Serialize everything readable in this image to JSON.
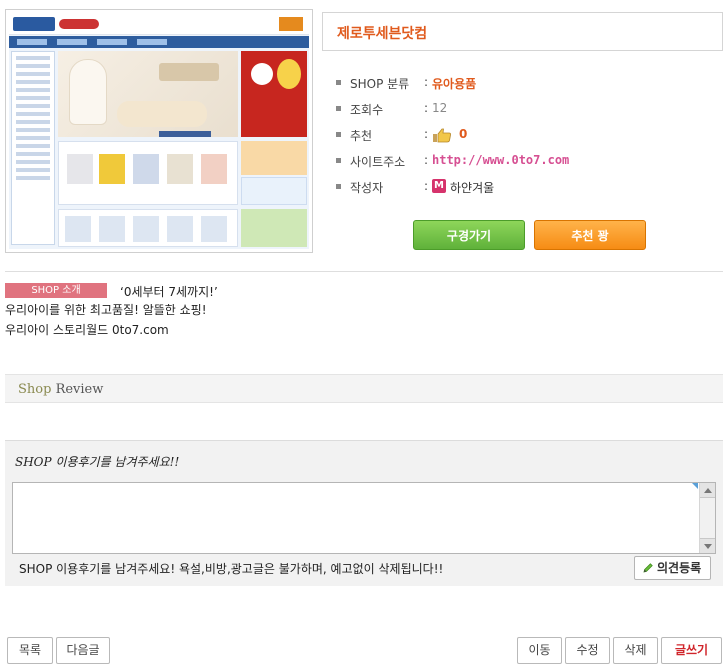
{
  "shop": {
    "name": "제로투세븐닷컴",
    "fields": {
      "category_label": "SHOP 분류",
      "category_value": "유아용품",
      "views_label": "조회수",
      "views_value": "12",
      "recommend_label": "추천",
      "recommend_value": "0",
      "url_label": "사이트주소",
      "url_value": "http://www.0to7.com",
      "author_label": "작성자",
      "author_badge": "M",
      "author_value": "하얀겨울"
    },
    "colon": ":",
    "buttons": {
      "visit": "구경가기",
      "recommend": "추천 꽝"
    }
  },
  "intro": {
    "badge": "SHOP 소개",
    "line1": "‘0세부터 7세까지!’",
    "line2": "우리아이를 위한 최고품질! 알뜰한 쇼핑!",
    "line3": "우리아이 스토리월드 0to7.com"
  },
  "review": {
    "header_accent": "Shop",
    "header_rest": " Review",
    "form_title": "SHOP 이용후기를 남겨주세요!!",
    "textarea_value": "",
    "note": "SHOP 이용후기를 남겨주세요! 욕설,비방,광고글은 불가하며, 예고없이 삭제됩니다!!",
    "submit": "의견등록"
  },
  "bottom": {
    "list": "목록",
    "next": "다음글",
    "move": "이동",
    "edit": "수정",
    "delete": "삭제",
    "write": "글쓰기"
  },
  "icons": {
    "thumb": "thumbs-up-icon",
    "pencil": "pencil-icon",
    "bullet": "bullet-square-icon"
  },
  "colors": {
    "accent_orange": "#e05a1d",
    "url_pink": "#d64f92",
    "visit_green": "#5fb13a",
    "recommend_orange": "#f68c14",
    "intro_badge": "#e0737f",
    "write_red": "#d0252b"
  }
}
